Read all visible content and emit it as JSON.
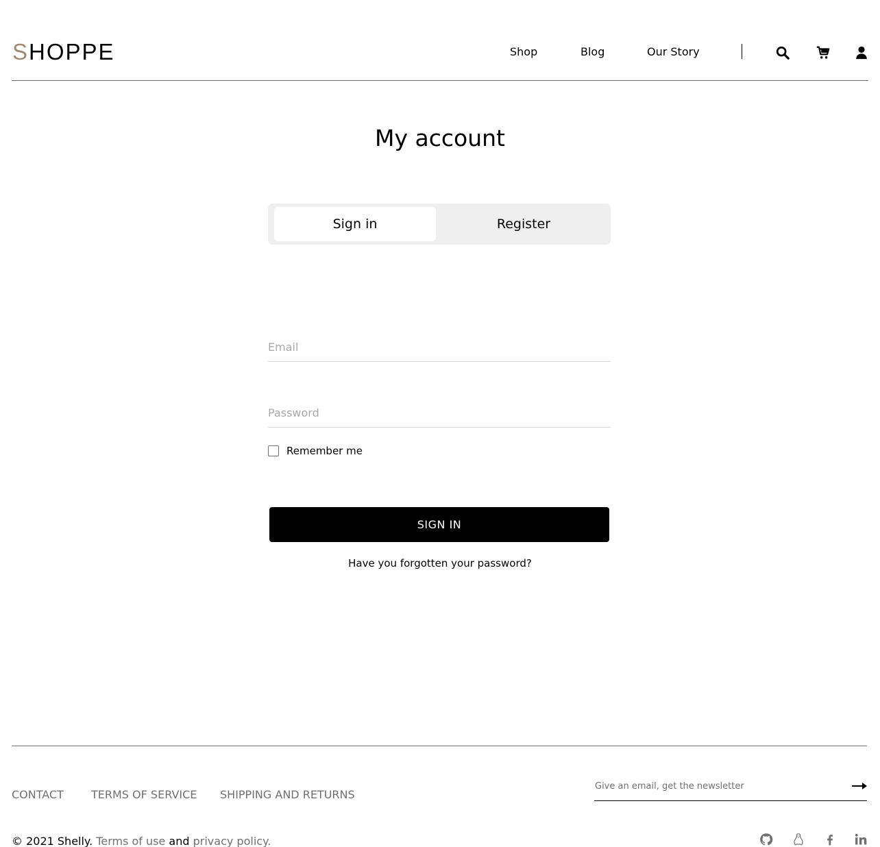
{
  "header": {
    "logo_first": "S",
    "logo_rest": "HOPPE",
    "nav": [
      {
        "label": "Shop"
      },
      {
        "label": "Blog"
      },
      {
        "label": "Our Story"
      }
    ],
    "icons": [
      "search-icon",
      "cart-icon",
      "user-icon"
    ]
  },
  "page": {
    "title": "My account"
  },
  "tabs": {
    "sign_in": "Sign in",
    "register": "Register"
  },
  "form": {
    "email_placeholder": "Email",
    "email_value": "",
    "password_placeholder": "Password",
    "password_value": "",
    "remember_label": "Remember me",
    "remember_checked": false,
    "submit_label": "SIGN IN",
    "forgot_label": "Have you forgotten your password?"
  },
  "footer": {
    "links": [
      {
        "label": "CONTACT"
      },
      {
        "label": "TERMS OF SERVICE"
      },
      {
        "label": "SHIPPING AND RETURNS"
      }
    ],
    "newsletter_placeholder": "Give an email, get the newsletter",
    "copyright_prefix": "© 2021 Shelly.",
    "terms_link": "Terms of use",
    "and_text": "and",
    "privacy_link": "privacy policy.",
    "social": [
      "github-icon",
      "linux-icon",
      "facebook-icon",
      "linkedin-icon"
    ]
  },
  "colors": {
    "accent": "#a18a68",
    "text": "#000000",
    "muted": "#707070",
    "tab_bg": "#efefef",
    "button": "#000000"
  }
}
